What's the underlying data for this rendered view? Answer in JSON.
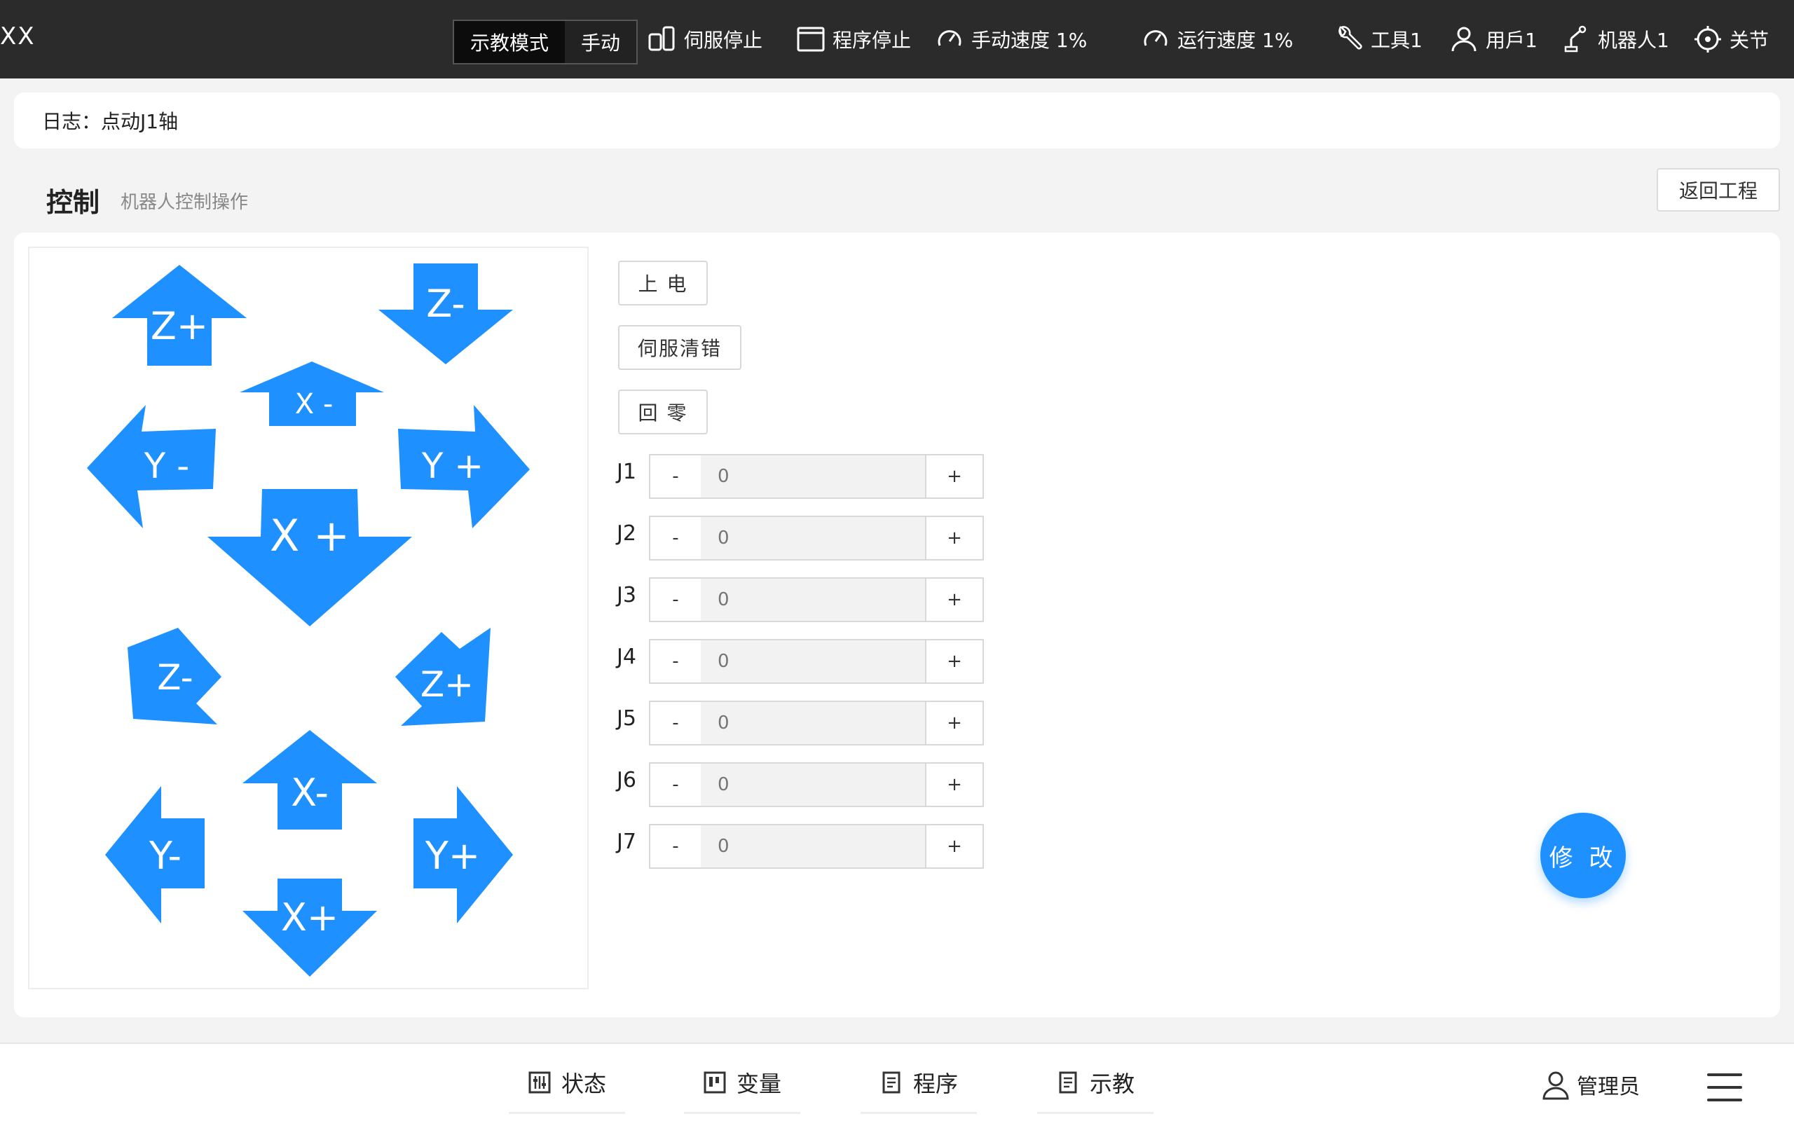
{
  "topbar": {
    "app_title": "XX",
    "mode": {
      "teach": "示教模式",
      "manual": "手动"
    },
    "servo_stop": "伺服停止",
    "program_stop": "程序停止",
    "manual_speed": "手动速度 1%",
    "run_speed": "运行速度 1%",
    "tool": "工具1",
    "user": "用戶1",
    "robot": "机器人1",
    "about": "关节"
  },
  "log": {
    "text": "日志：点动J1轴"
  },
  "section": {
    "title": "控制",
    "subtitle": "机器人控制操作",
    "back_label": "返回工程"
  },
  "jog_arrows": [
    "Z+",
    "Z-",
    "X -",
    "Y -",
    "Y +",
    "X +",
    "Z-",
    "Z+",
    "X-",
    "Y-",
    "Y+",
    "X+"
  ],
  "controls": {
    "power_on": "上 电",
    "servo_clear": "伺服清错",
    "home": "回 零"
  },
  "joints": [
    {
      "label": "J1",
      "value": "0"
    },
    {
      "label": "J2",
      "value": "0"
    },
    {
      "label": "J3",
      "value": "0"
    },
    {
      "label": "J4",
      "value": "0"
    },
    {
      "label": "J5",
      "value": "0"
    },
    {
      "label": "J6",
      "value": "0"
    },
    {
      "label": "J7",
      "value": "0"
    }
  ],
  "stepper": {
    "minus": "-",
    "plus": "+"
  },
  "modify_label": "修 改",
  "bottom_nav": {
    "status": "状态",
    "variables": "变量",
    "program": "程序",
    "teach": "示教"
  },
  "user_role": "管理员",
  "colors": {
    "accent": "#1e90ff",
    "topbar": "#2b2b2b"
  }
}
